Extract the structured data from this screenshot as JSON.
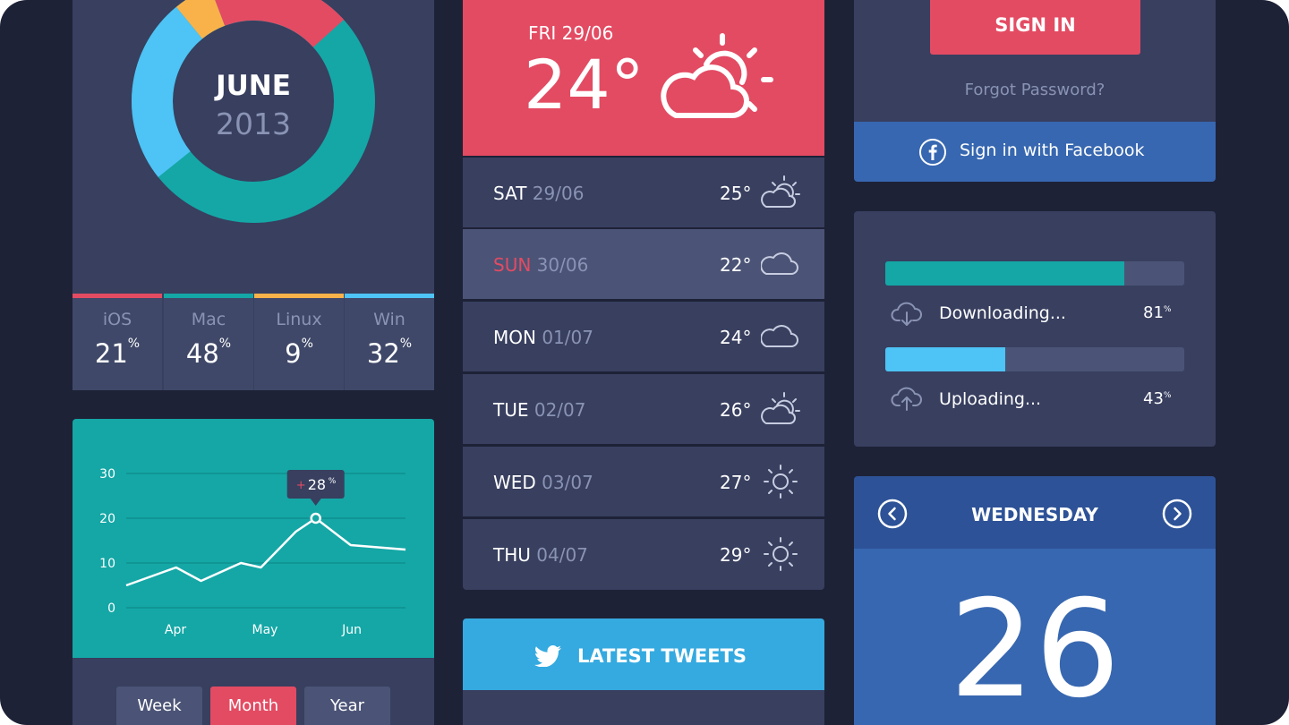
{
  "donut": {
    "month": "JUNE",
    "year": "2013",
    "stats": [
      {
        "name": "iOS",
        "value": "21",
        "unit": "%",
        "color": "#e34b63"
      },
      {
        "name": "Mac",
        "value": "48",
        "unit": "%",
        "color": "#14a7a6"
      },
      {
        "name": "Linux",
        "value": "9",
        "unit": "%",
        "color": "#f9b24a"
      },
      {
        "name": "Win",
        "value": "32",
        "unit": "%",
        "color": "#4ec3f5"
      }
    ]
  },
  "chart_data": {
    "type": "line",
    "y_ticks": [
      "30",
      "20",
      "10",
      "0"
    ],
    "x_ticks": [
      "Apr",
      "May",
      "Jun"
    ],
    "ylim": [
      0,
      30
    ],
    "points": [
      [
        0,
        5
      ],
      [
        1,
        9
      ],
      [
        1.5,
        6
      ],
      [
        2.3,
        10
      ],
      [
        2.7,
        9
      ],
      [
        3.4,
        17
      ],
      [
        3.8,
        20
      ],
      [
        4.5,
        14
      ],
      [
        5.6,
        13
      ]
    ],
    "callout": {
      "label": "28",
      "unit": "%",
      "point_index": 6
    },
    "grid": true
  },
  "range": {
    "options": [
      "Week",
      "Month",
      "Year"
    ],
    "selected": "Month"
  },
  "weather": {
    "date": "FRI  29/06",
    "temp": "24°",
    "forecast": [
      {
        "day": "SAT",
        "date": "29/06",
        "temp": "25°",
        "icon": "partly-cloudy-icon"
      },
      {
        "day": "SUN",
        "date": "30/06",
        "temp": "22°",
        "icon": "cloud-icon",
        "highlight": true
      },
      {
        "day": "MON",
        "date": "01/07",
        "temp": "24°",
        "icon": "cloud-icon"
      },
      {
        "day": "TUE",
        "date": "02/07",
        "temp": "26°",
        "icon": "partly-cloudy-icon"
      },
      {
        "day": "WED",
        "date": "03/07",
        "temp": "27°",
        "icon": "sun-icon"
      },
      {
        "day": "THU",
        "date": "04/07",
        "temp": "29°",
        "icon": "sun-icon"
      }
    ]
  },
  "tweets": {
    "title": "LATEST TWEETS"
  },
  "login": {
    "signin_label": "SIGN IN",
    "forgot_label": "Forgot Password?",
    "facebook_label": "Sign in with Facebook"
  },
  "transfers": [
    {
      "label": "Downloading...",
      "percent": "81",
      "unit": "%",
      "progress": 0.8,
      "color": "#14a7a6",
      "icon": "cloud-download-icon"
    },
    {
      "label": "Uploading...",
      "percent": "43",
      "unit": "%",
      "progress": 0.4,
      "color": "#4ec3f5",
      "icon": "cloud-upload-icon"
    }
  ],
  "calendar": {
    "weekday": "WEDNESDAY",
    "day": "26"
  }
}
